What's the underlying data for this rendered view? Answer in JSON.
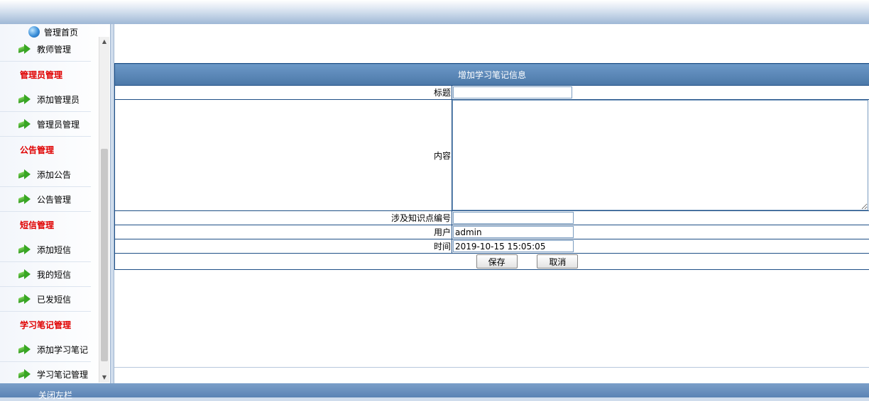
{
  "sidebar": {
    "home_label": "管理首页",
    "groups": [
      {
        "title": "",
        "items": [
          "教师管理"
        ]
      },
      {
        "title": "管理员管理",
        "items": [
          "添加管理员",
          "管理员管理"
        ]
      },
      {
        "title": "公告管理",
        "items": [
          "添加公告",
          "公告管理"
        ]
      },
      {
        "title": "短信管理",
        "items": [
          "添加短信",
          "我的短信",
          "已发短信"
        ]
      },
      {
        "title": "学习笔记管理",
        "items": [
          "添加学习笔记",
          "学习笔记管理"
        ]
      }
    ]
  },
  "bottom": {
    "close_label": "关闭左栏"
  },
  "form": {
    "header": "增加学习笔记信息",
    "title_label": "标题",
    "title_value": "",
    "content_label": "内容",
    "content_value": "",
    "knowledge_label": "涉及知识点编号",
    "knowledge_value": "",
    "user_label": "用户",
    "user_value": "admin",
    "time_label": "时间",
    "time_value": "2019-10-15 15:05:05",
    "save_label": "保存",
    "cancel_label": "取消"
  },
  "colors": {
    "header_bg": "#5f8bb8",
    "border": "#1e4f86",
    "group_title": "#e00000"
  }
}
